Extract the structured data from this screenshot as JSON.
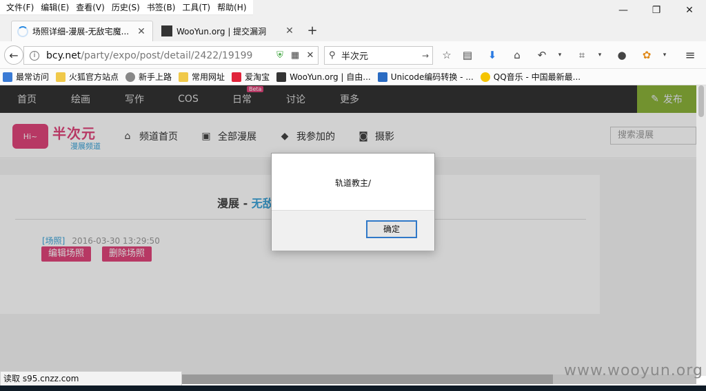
{
  "menu": [
    "文件(F)",
    "编辑(E)",
    "查看(V)",
    "历史(S)",
    "书签(B)",
    "工具(T)",
    "帮助(H)"
  ],
  "window_controls": {
    "minimize": "—",
    "restore": "❐",
    "close": "✕"
  },
  "tabs": [
    {
      "label": "场照详细-漫展-无敌宅魔...",
      "active": true
    },
    {
      "label": "WooYun.org | 提交漏洞",
      "active": false
    }
  ],
  "new_tab_label": "+",
  "nav": {
    "back": "←",
    "url_host": "bcy.net",
    "url_path": "/party/expo/post/detail/2422/19199",
    "search_value": "半次元",
    "search_go": "→"
  },
  "bookmarks": [
    "最常访问",
    "火狐官方站点",
    "新手上路",
    "常用网址",
    "爱淘宝",
    "WooYun.org | 自由...",
    "Unicode编码转换 - ...",
    "QQ音乐 - 中国最新最..."
  ],
  "site_nav": {
    "items": [
      "首页",
      "绘画",
      "写作",
      "COS",
      "日常",
      "讨论",
      "更多"
    ],
    "beta_badge": "Beta",
    "publish": "发布"
  },
  "logo": {
    "mark": "Hi~",
    "title": "半次元",
    "subtitle": "漫展频道"
  },
  "sub_nav": [
    {
      "label": "频道首页",
      "icon": "home-icon"
    },
    {
      "label": "全部漫展",
      "icon": "gift-icon"
    },
    {
      "label": "我参加的",
      "icon": "tag-icon"
    },
    {
      "label": "摄影",
      "icon": "camera-icon"
    }
  ],
  "search_placeholder": "搜索漫展",
  "card": {
    "title_prefix": "漫展 - ",
    "title_highlight": "无敌",
    "tag": "[场照]",
    "date": "2016-03-30 13:29:50",
    "edit_button": "编辑场照",
    "delete_button": "删除场照"
  },
  "dialog": {
    "message": "轨道教主/",
    "ok": "确定"
  },
  "status_text": "读取 s95.cnzz.com",
  "watermark": "www.wooyun.org",
  "colors": {
    "accent_pink": "#e0457b",
    "accent_blue": "#3aa3d8",
    "publish_green": "#8cb33a",
    "nav_dark": "#333333"
  }
}
